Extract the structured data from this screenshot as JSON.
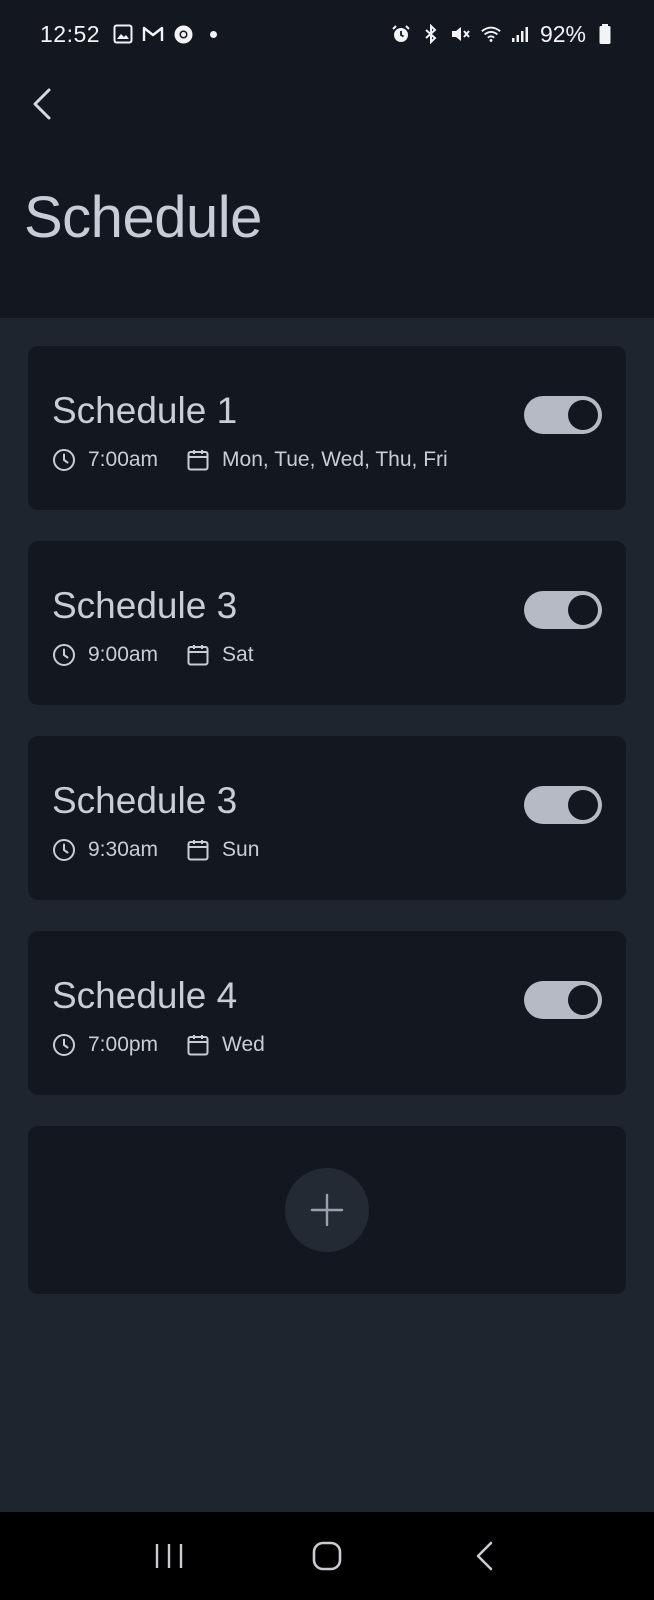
{
  "status_bar": {
    "time": "12:52",
    "battery": "92%",
    "left_icons": [
      "gallery-icon",
      "gmail-icon",
      "chrome-icon",
      "dot"
    ],
    "right_icons": [
      "alarm-icon",
      "bluetooth-icon",
      "mute-icon",
      "wifi-icon",
      "signal-icon",
      "battery-icon"
    ]
  },
  "header": {
    "title": "Schedule"
  },
  "schedules": [
    {
      "name": "Schedule 1",
      "time": "7:00am",
      "days": "Mon, Tue, Wed, Thu, Fri",
      "enabled": true
    },
    {
      "name": "Schedule 3",
      "time": "9:00am",
      "days": "Sat",
      "enabled": true
    },
    {
      "name": "Schedule 3",
      "time": "9:30am",
      "days": "Sun",
      "enabled": true
    },
    {
      "name": "Schedule 4",
      "time": "7:00pm",
      "days": "Wed",
      "enabled": true
    }
  ],
  "colors": {
    "background": "#1f252e",
    "card": "#131720",
    "text": "#c9cdd6",
    "toggle_on": "#b5bac4"
  }
}
